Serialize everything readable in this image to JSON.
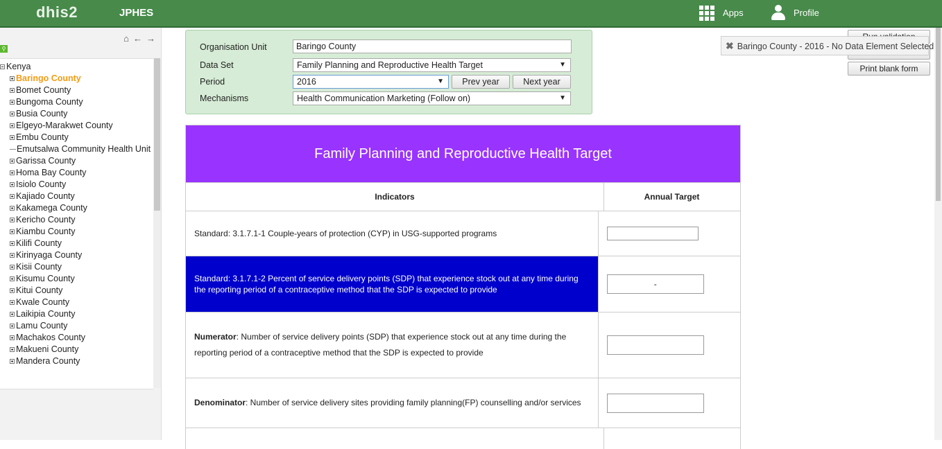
{
  "header": {
    "logo": "dhis2",
    "app_name": "JPHES",
    "apps_label": "Apps",
    "profile_label": "Profile"
  },
  "tree": {
    "root": "Kenya",
    "items": [
      {
        "label": "Baringo County",
        "selected": true,
        "expandable": true
      },
      {
        "label": "Bomet County",
        "expandable": true
      },
      {
        "label": "Bungoma County",
        "expandable": true
      },
      {
        "label": "Busia County",
        "expandable": true
      },
      {
        "label": "Elgeyo-Marakwet County",
        "expandable": true
      },
      {
        "label": "Embu County",
        "expandable": true
      },
      {
        "label": "Emutsalwa Community Health Unit",
        "expandable": false
      },
      {
        "label": "Garissa County",
        "expandable": true
      },
      {
        "label": "Homa Bay County",
        "expandable": true
      },
      {
        "label": "Isiolo County",
        "expandable": true
      },
      {
        "label": "Kajiado County",
        "expandable": true
      },
      {
        "label": "Kakamega County",
        "expandable": true
      },
      {
        "label": "Kericho County",
        "expandable": true
      },
      {
        "label": "Kiambu County",
        "expandable": true
      },
      {
        "label": "Kilifi County",
        "expandable": true
      },
      {
        "label": "Kirinyaga County",
        "expandable": true
      },
      {
        "label": "Kisii County",
        "expandable": true
      },
      {
        "label": "Kisumu County",
        "expandable": true
      },
      {
        "label": "Kitui County",
        "expandable": true
      },
      {
        "label": "Kwale County",
        "expandable": true
      },
      {
        "label": "Laikipia County",
        "expandable": true
      },
      {
        "label": "Lamu County",
        "expandable": true
      },
      {
        "label": "Machakos County",
        "expandable": true
      },
      {
        "label": "Makueni County",
        "expandable": true
      },
      {
        "label": "Mandera County",
        "expandable": true
      }
    ]
  },
  "selection": {
    "org_unit_label": "Organisation Unit",
    "org_unit_value": "Baringo County",
    "dataset_label": "Data Set",
    "dataset_value": "Family Planning and Reproductive Health Target",
    "period_label": "Period",
    "period_value": "2016",
    "prev_year": "Prev year",
    "next_year": "Next year",
    "mechanisms_label": "Mechanisms",
    "mechanisms_value": "Health Communication Marketing (Follow on)"
  },
  "actions": {
    "run_validation": "Run validation",
    "print_form": "Print form",
    "print_blank_form": "Print blank form"
  },
  "message": "Baringo County - 2016 - No Data Element Selected",
  "form": {
    "title": "Family Planning and Reproductive Health Target",
    "col_indicators": "Indicators",
    "col_target": "Annual Target",
    "rows": [
      {
        "text": "Standard: 3.1.7.1-1 Couple-years of protection (CYP) in USG-supported programs",
        "value": ""
      },
      {
        "text": "Standard: 3.1.7.1-2 Percent of service delivery points (SDP) that experience stock out at any time during the reporting period of a contraceptive method that the SDP is expected to provide",
        "value": "-"
      },
      {
        "bold": "Numerator",
        "text": ": Number of service delivery points (SDP) that experience stock out at any time during the reporting period of a contraceptive method that the SDP is expected to provide",
        "value": ""
      },
      {
        "bold": "Denominator",
        "text": ": Number of service delivery sites providing family planning(FP) counselling and/or services",
        "value": ""
      }
    ]
  },
  "colors": {
    "header_green": "#478a4a",
    "title_purple": "#9933ff",
    "highlight_blue": "#0000cc",
    "selected_orange": "#f39c12"
  }
}
